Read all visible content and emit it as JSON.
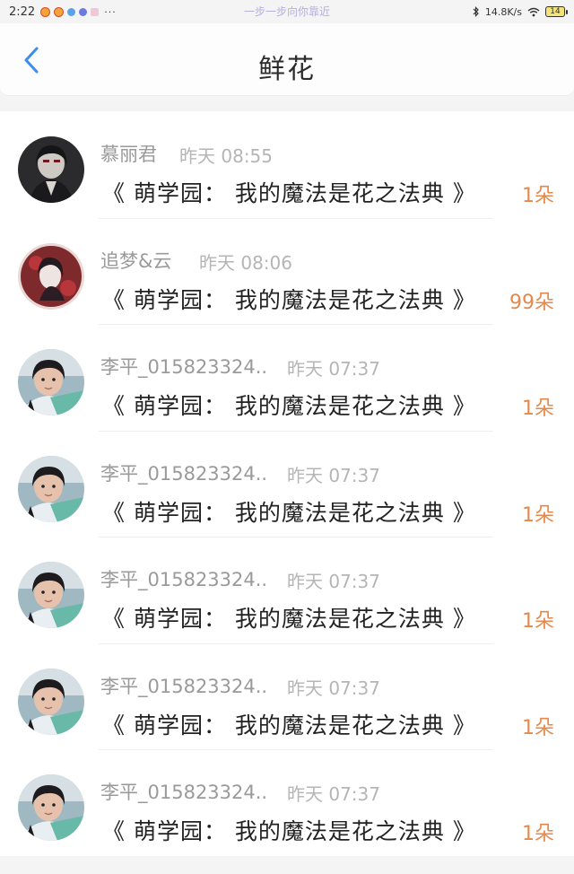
{
  "status_bar": {
    "time": "2:22",
    "more": "···",
    "center_text": "一步一步向你靠近",
    "network_speed": "14.8K/s",
    "battery": "14",
    "icons": [
      "weibo-icon",
      "weibo-icon",
      "app-icon",
      "app-icon",
      "app-icon",
      "bluetooth-icon",
      "wifi-icon",
      "battery-icon"
    ]
  },
  "header": {
    "title": "鲜花",
    "back_icon": "chevron-left-icon",
    "back_color": "#3a8ef0"
  },
  "gifts": [
    {
      "name": "慕丽君",
      "time": "昨天 08:55",
      "book": "《 萌学园： 我的魔法是花之法典 》",
      "count": "1朵",
      "avatar": "dark-portrait"
    },
    {
      "name": "追梦&云",
      "time": "昨天 08:06",
      "book": "《 萌学园： 我的魔法是花之法典 》",
      "count": "99朵",
      "avatar": "red-portrait"
    },
    {
      "name": "李平_015823324..",
      "time": "昨天 07:37",
      "book": "《 萌学园： 我的魔法是花之法典 》",
      "count": "1朵",
      "avatar": "girl-photo"
    },
    {
      "name": "李平_015823324..",
      "time": "昨天 07:37",
      "book": "《 萌学园： 我的魔法是花之法典 》",
      "count": "1朵",
      "avatar": "girl-photo"
    },
    {
      "name": "李平_015823324..",
      "time": "昨天 07:37",
      "book": "《 萌学园： 我的魔法是花之法典 》",
      "count": "1朵",
      "avatar": "girl-photo"
    },
    {
      "name": "李平_015823324..",
      "time": "昨天 07:37",
      "book": "《 萌学园： 我的魔法是花之法典 》",
      "count": "1朵",
      "avatar": "girl-photo"
    },
    {
      "name": "李平_015823324..",
      "time": "昨天 07:37",
      "book": "《 萌学园： 我的魔法是花之法典 》",
      "count": "1朵",
      "avatar": "girl-photo"
    }
  ],
  "colors": {
    "accent": "#3a8ef0",
    "count": "#e4894b",
    "muted_text": "#9a9a9a"
  }
}
